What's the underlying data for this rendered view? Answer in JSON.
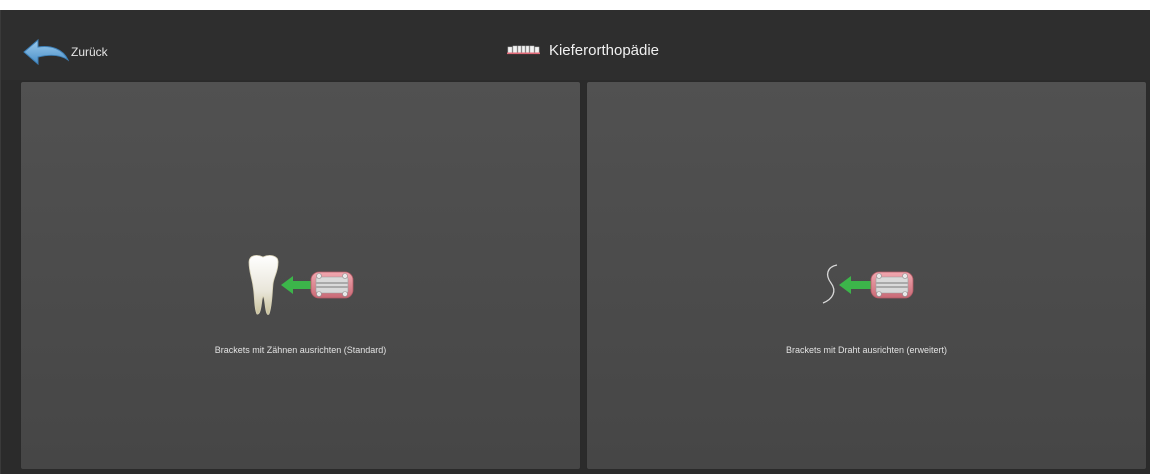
{
  "header": {
    "back_label": "Zurück",
    "title": "Kieferorthopädie",
    "title_icon": "dentition-icon",
    "back_icon": "back-arrow-icon"
  },
  "panels": [
    {
      "label": "Brackets mit Zähnen ausrichten (Standard)",
      "icons": [
        "tooth-icon",
        "arrow-left-icon",
        "bracket-icon"
      ]
    },
    {
      "label": "Brackets mit Draht ausrichten (erweitert)",
      "icons": [
        "wire-icon",
        "arrow-left-icon",
        "bracket-icon"
      ]
    }
  ],
  "colors": {
    "background": "#2b2b2b",
    "panel": "#4d4d4d",
    "text": "#e6e6e6",
    "back_arrow": "#6aa6d6",
    "arrow": "#3cb54a",
    "bracket": "#e88a94"
  }
}
